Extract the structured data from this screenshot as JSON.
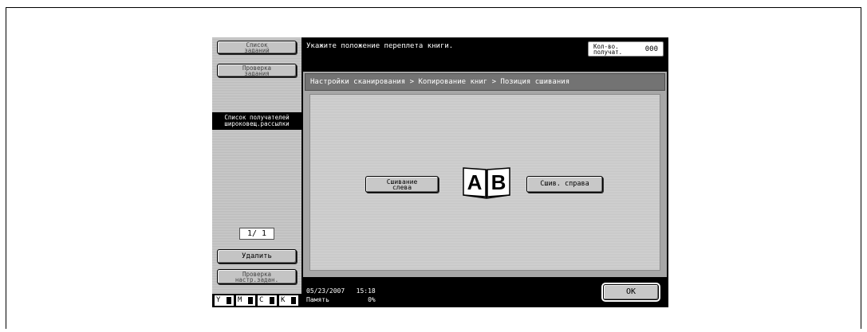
{
  "sidebar": {
    "job_list_label": "Список\nзаданий",
    "job_check_label": "Проверка\nзадания",
    "recipient_list_label": "Список получателей\nшироковещ.рассылки",
    "page_indicator": "1/  1",
    "delete_label": "Удалить",
    "check_settings_label": "Проверка\nнастр.задан."
  },
  "toner": [
    {
      "label": "Y",
      "icon": "toner-bar"
    },
    {
      "label": "M",
      "icon": "toner-bar"
    },
    {
      "label": "C",
      "icon": "toner-bar"
    },
    {
      "label": "K",
      "icon": "toner-bar"
    }
  ],
  "header": {
    "message": "Укажите положение переплета книги.",
    "counter_label": "Кол-во.\nполучат.",
    "counter_value": "000"
  },
  "breadcrumb": "Настройки сканирования > Копирование книг > Позиция сшивания",
  "options": {
    "left_binding_label": "Сшивание\nслева",
    "right_binding_label": "Сшив. справа",
    "book_icon": "open-book-ab-icon",
    "book_letters": [
      "A",
      "B"
    ]
  },
  "status": {
    "date": "05/23/2007",
    "time": "15:18",
    "memory_label": "Память",
    "memory_value": "0%"
  },
  "ok_label": "OK",
  "colors": {
    "screen_bg": "#000000",
    "panel_gray": "#a7a7a7",
    "breadcrumb_bg": "#737373"
  }
}
